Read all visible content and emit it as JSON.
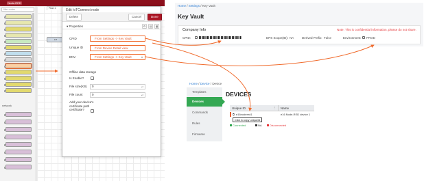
{
  "nodered": {
    "logo": "Node-RED",
    "filter_placeholder": "filter nodes",
    "palette_nodes": [
      "",
      "",
      "",
      "",
      "",
      "",
      "",
      "",
      "",
      "",
      "",
      "",
      "",
      "",
      "",
      "",
      "",
      "",
      "",
      ""
    ],
    "category_network": "network",
    "tab_label": "Flow 1",
    "flow_node_label": "IoT"
  },
  "tray": {
    "title": "Edit IoTConnect node",
    "delete_label": "Delete",
    "cancel_label": "Cancel",
    "done_label": "Done",
    "properties_label": "Properties",
    "fields": {
      "cpid_label": "CPID",
      "cpid_value": "From Settings -> Key Vault",
      "uid_label": "Unique ID",
      "uid_value": "From Device Detail view",
      "env_label": "ENV",
      "env_value": "From Settings -> Key Vault",
      "offline_heading": "Offline data storage",
      "is_enabled_label": "Is Enable?",
      "file_size_label": "File size(KB)",
      "file_size_value": "0",
      "file_count_label": "File count",
      "file_count_value": "0",
      "cert_label": "Add your device's certificate path",
      "cert_check_label": "certificate?"
    }
  },
  "keyvault": {
    "breadcrumb_home": "Home",
    "breadcrumb_settings": "Settings",
    "breadcrumb_current": "Key Vault",
    "title": "Key Vault",
    "company_info": "Company Info",
    "note": "Note: This is confidential information, please do not share.",
    "cpid_label": "CPID:",
    "dps_label": "DPS Scope(ID):",
    "dps_value": "NA",
    "derived_label": "Derived Prefix:",
    "derived_value": "False",
    "env_label": "Environment:",
    "env_value": "PROD"
  },
  "devices": {
    "breadcrumb_home": "Home",
    "breadcrumb_device": "Device",
    "breadcrumb_current": "Device",
    "title": "DEVICES",
    "nav": [
      "Templates",
      "Devices",
      "Commands",
      "Rules",
      "Firmware"
    ],
    "col_unique_id": "Unique ID",
    "col_name": "Name",
    "row_id": "e16nodered1",
    "row_name": "e16 Node-RED device 1",
    "tooltip": "Click to copy uniqueId",
    "legend_connected": "Connected",
    "legend_na": "NA",
    "legend_disconnected": "Disconnected"
  },
  "colors": {
    "annotation": "#f06a2b",
    "done_button": "#ad1625",
    "active_nav": "#34a853",
    "note_red": "#e6393c"
  }
}
